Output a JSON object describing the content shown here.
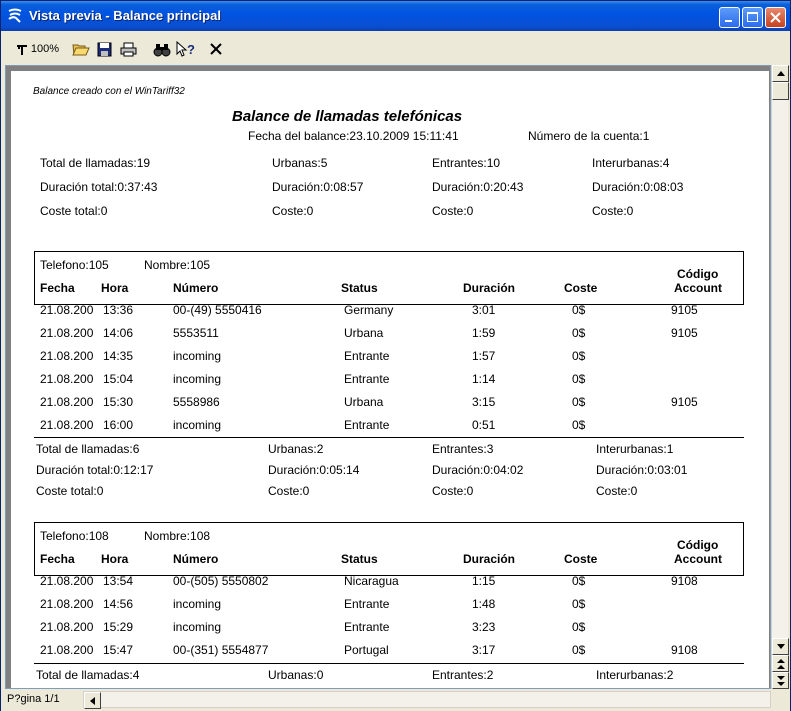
{
  "window": {
    "title": "Vista previa - Balance principal"
  },
  "toolbar": {
    "zoom_label": "100%",
    "icons": [
      "zoom-icon",
      "open-folder-icon",
      "save-icon",
      "print-icon",
      "find-icon",
      "help-icon",
      "close-x-icon"
    ]
  },
  "report": {
    "created_by": "Balance creado con el WinTariff32",
    "title": "Balance de llamadas telefónicas",
    "date": "Fecha del balance:23.10.2009 15:11:41",
    "account": "Número de la cuenta:1",
    "summary": {
      "row1": [
        "Total de llamadas:19",
        "Urbanas:5",
        "Entrantes:10",
        "Interurbanas:4"
      ],
      "row2": [
        "Duración total:0:37:43",
        "Duración:0:08:57",
        "Duración:0:20:43",
        "Duración:0:08:03"
      ],
      "row3": [
        "Coste total:0",
        "Coste:0",
        "Coste:0",
        "Coste:0"
      ]
    },
    "columns": {
      "fecha": "Fecha",
      "hora": "Hora",
      "numero": "Número",
      "status": "Status",
      "duracion": "Duración",
      "coste": "Coste",
      "codigo_1": "Código",
      "codigo_2": "Account"
    },
    "groups": [
      {
        "telefono": "Telefono:105",
        "nombre": "Nombre:105",
        "rows": [
          [
            "21.08.200",
            "13:36",
            "00-(49) 5550416",
            "Germany",
            "3:01",
            "0$",
            "9105"
          ],
          [
            "21.08.200",
            "14:06",
            "5553511",
            "Urbana",
            "1:59",
            "0$",
            "9105"
          ],
          [
            "21.08.200",
            "14:35",
            "incoming",
            "Entrante",
            "1:57",
            "0$",
            ""
          ],
          [
            "21.08.200",
            "15:04",
            "incoming",
            "Entrante",
            "1:14",
            "0$",
            ""
          ],
          [
            "21.08.200",
            "15:30",
            "5558986",
            "Urbana",
            "3:15",
            "0$",
            "9105"
          ],
          [
            "21.08.200",
            "16:00",
            "incoming",
            "Entrante",
            "0:51",
            "0$",
            ""
          ]
        ],
        "totals": {
          "row1": [
            "Total de llamadas:6",
            "Urbanas:2",
            "Entrantes:3",
            "Interurbanas:1"
          ],
          "row2": [
            "Duración total:0:12:17",
            "Duración:0:05:14",
            "Duración:0:04:02",
            "Duración:0:03:01"
          ],
          "row3": [
            "Coste total:0",
            "Coste:0",
            "Coste:0",
            "Coste:0"
          ]
        }
      },
      {
        "telefono": "Telefono:108",
        "nombre": "Nombre:108",
        "rows": [
          [
            "21.08.200",
            "13:54",
            "00-(505) 5550802",
            "Nicaragua",
            "1:15",
            "0$",
            "9108"
          ],
          [
            "21.08.200",
            "14:56",
            "incoming",
            "Entrante",
            "1:48",
            "0$",
            ""
          ],
          [
            "21.08.200",
            "15:29",
            "incoming",
            "Entrante",
            "3:23",
            "0$",
            ""
          ],
          [
            "21.08.200",
            "15:47",
            "00-(351) 5554877",
            "Portugal",
            "3:17",
            "0$",
            "9108"
          ]
        ],
        "totals": {
          "row1": [
            "Total de llamadas:4",
            "Urbanas:0",
            "Entrantes:2",
            "Interurbanas:2"
          ]
        }
      }
    ]
  },
  "statusbar": {
    "page_indicator": "P?gina 1/1"
  }
}
